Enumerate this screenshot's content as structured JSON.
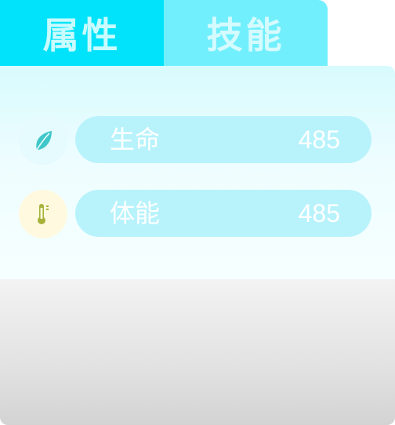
{
  "tabs": {
    "attributes_label": "属性",
    "skills_label": "技能"
  },
  "stats": [
    {
      "label": "生命",
      "value": "485",
      "icon": "leaf-icon"
    },
    {
      "label": "体能",
      "value": "485",
      "icon": "thermometer-icon"
    }
  ],
  "colors": {
    "active_tab": "#00e3fb",
    "inactive_tab": "#72effd",
    "stat_bar": "#b8f3fc",
    "leaf": "#3fc7c9",
    "thermometer": "#a6b23a"
  }
}
